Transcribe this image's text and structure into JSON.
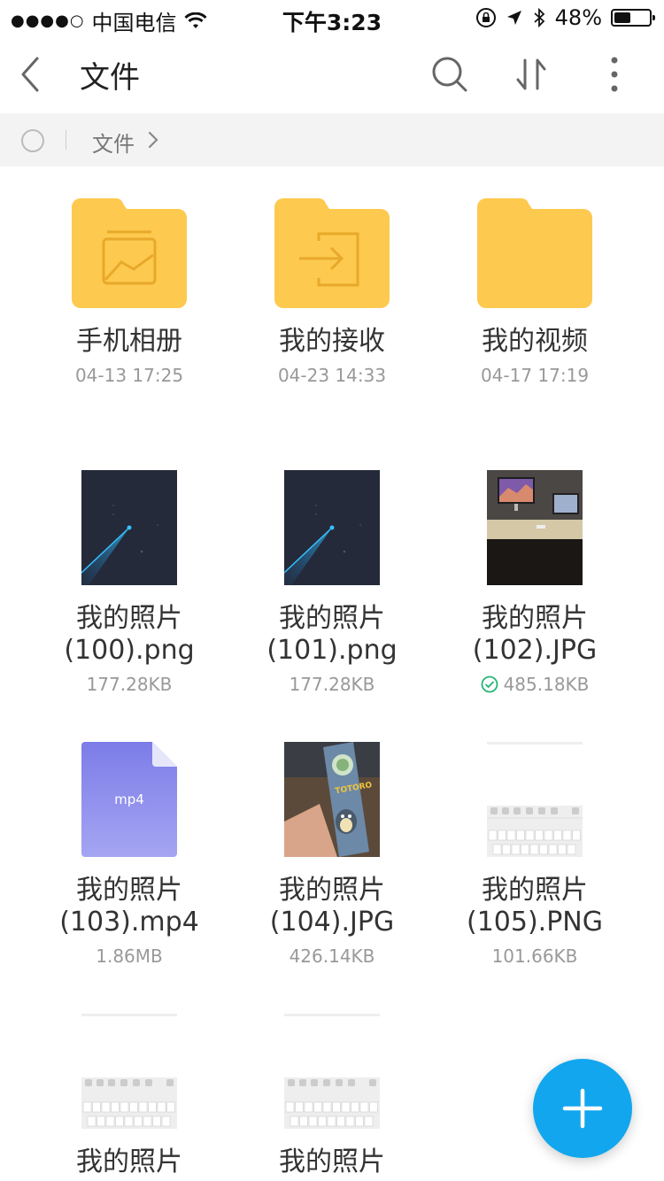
{
  "status_bar": {
    "signal": "●●●●○",
    "carrier": "中国电信",
    "time": "下午3:23",
    "battery": "48%",
    "battery_level": 0.48
  },
  "nav": {
    "title": "文件"
  },
  "breadcrumb": {
    "current": "文件"
  },
  "folders": [
    {
      "name": "手机相册",
      "date": "04-13 17:25",
      "icon": "image-icon"
    },
    {
      "name": "我的接收",
      "date": "04-23 14:33",
      "icon": "import-icon"
    },
    {
      "name": "我的视频",
      "date": "04-17 17:19",
      "icon": "none"
    }
  ],
  "files": [
    {
      "name_line1": "我的照片",
      "name_line2": "(100).png",
      "size": "177.28KB",
      "thumb": "dark-chart"
    },
    {
      "name_line1": "我的照片",
      "name_line2": "(101).png",
      "size": "177.28KB",
      "thumb": "dark-chart"
    },
    {
      "name_line1": "我的照片",
      "name_line2": "(102).JPG",
      "size": "485.18KB",
      "thumb": "desk-photo",
      "synced": true
    },
    {
      "name_line1": "我的照片",
      "name_line2": "(103).mp4",
      "size": "1.86MB",
      "thumb": "mp4-file",
      "type_label": "mp4"
    },
    {
      "name_line1": "我的照片",
      "name_line2": "(104).JPG",
      "size": "426.14KB",
      "thumb": "totoro-photo"
    },
    {
      "name_line1": "我的照片",
      "name_line2": "(105).PNG",
      "size": "101.66KB",
      "thumb": "keyboard-screenshot"
    },
    {
      "name_line1": "我的照片",
      "thumb": "keyboard-screenshot"
    },
    {
      "name_line1": "我的照片",
      "thumb": "keyboard-screenshot"
    }
  ],
  "colors": {
    "folder": "#fdc94f",
    "folder_line": "#e8a92a",
    "fab": "#12a6ee",
    "mp4": "#8f8ff0",
    "check": "#22b573"
  }
}
